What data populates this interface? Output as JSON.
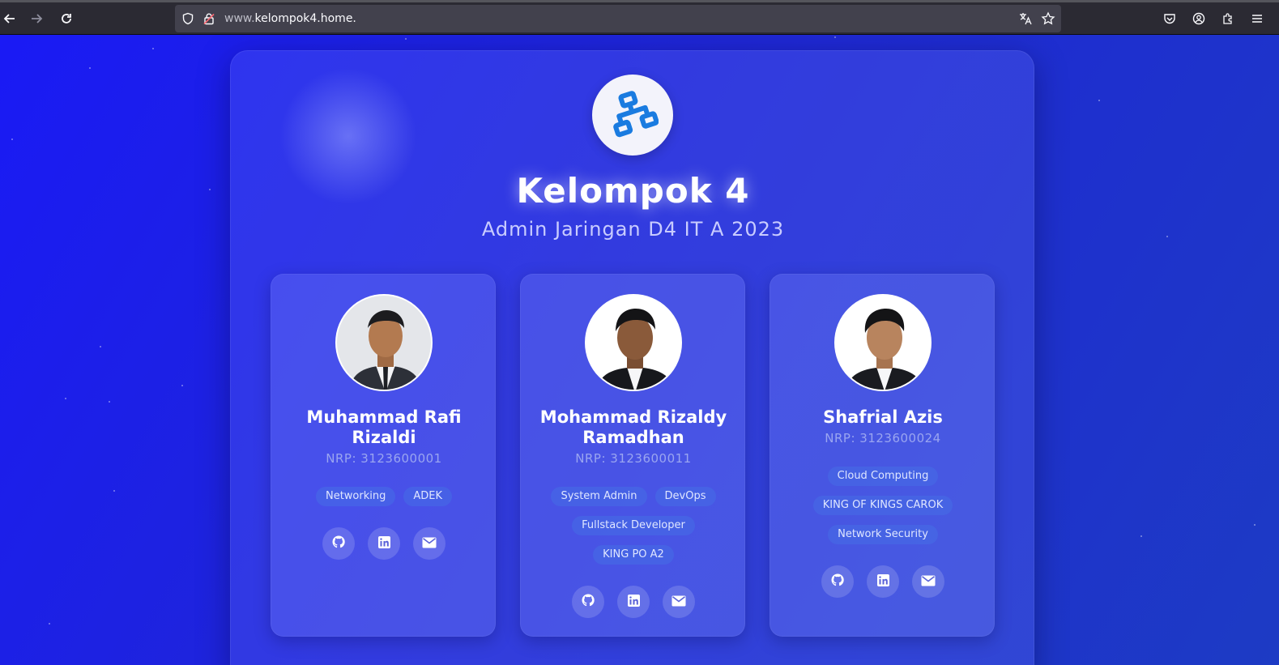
{
  "browser": {
    "url_prefix": "www.",
    "url_domain": "kelompok4.home."
  },
  "header": {
    "title": "Kelompok 4",
    "subtitle": "Admin Jaringan D4 IT A 2023"
  },
  "members": [
    {
      "name": "Muhammad Rafi Rizaldi",
      "nrp": "NRP: 3123600001",
      "tags": [
        "Networking",
        "ADEK"
      ]
    },
    {
      "name": "Mohammad Rizaldy Ramadhan",
      "nrp": "NRP: 3123600011",
      "tags": [
        "System Admin",
        "DevOps",
        "Fullstack Developer",
        "KING PO A2"
      ]
    },
    {
      "name": "Shafrial Azis",
      "nrp": "NRP: 3123600024",
      "tags": [
        "Cloud Computing",
        "KING OF KINGS CAROK",
        "Network Security"
      ]
    }
  ],
  "icons": {
    "logo": "sitemap-icon",
    "social": [
      "github-icon",
      "linkedin-icon",
      "envelope-icon"
    ]
  }
}
